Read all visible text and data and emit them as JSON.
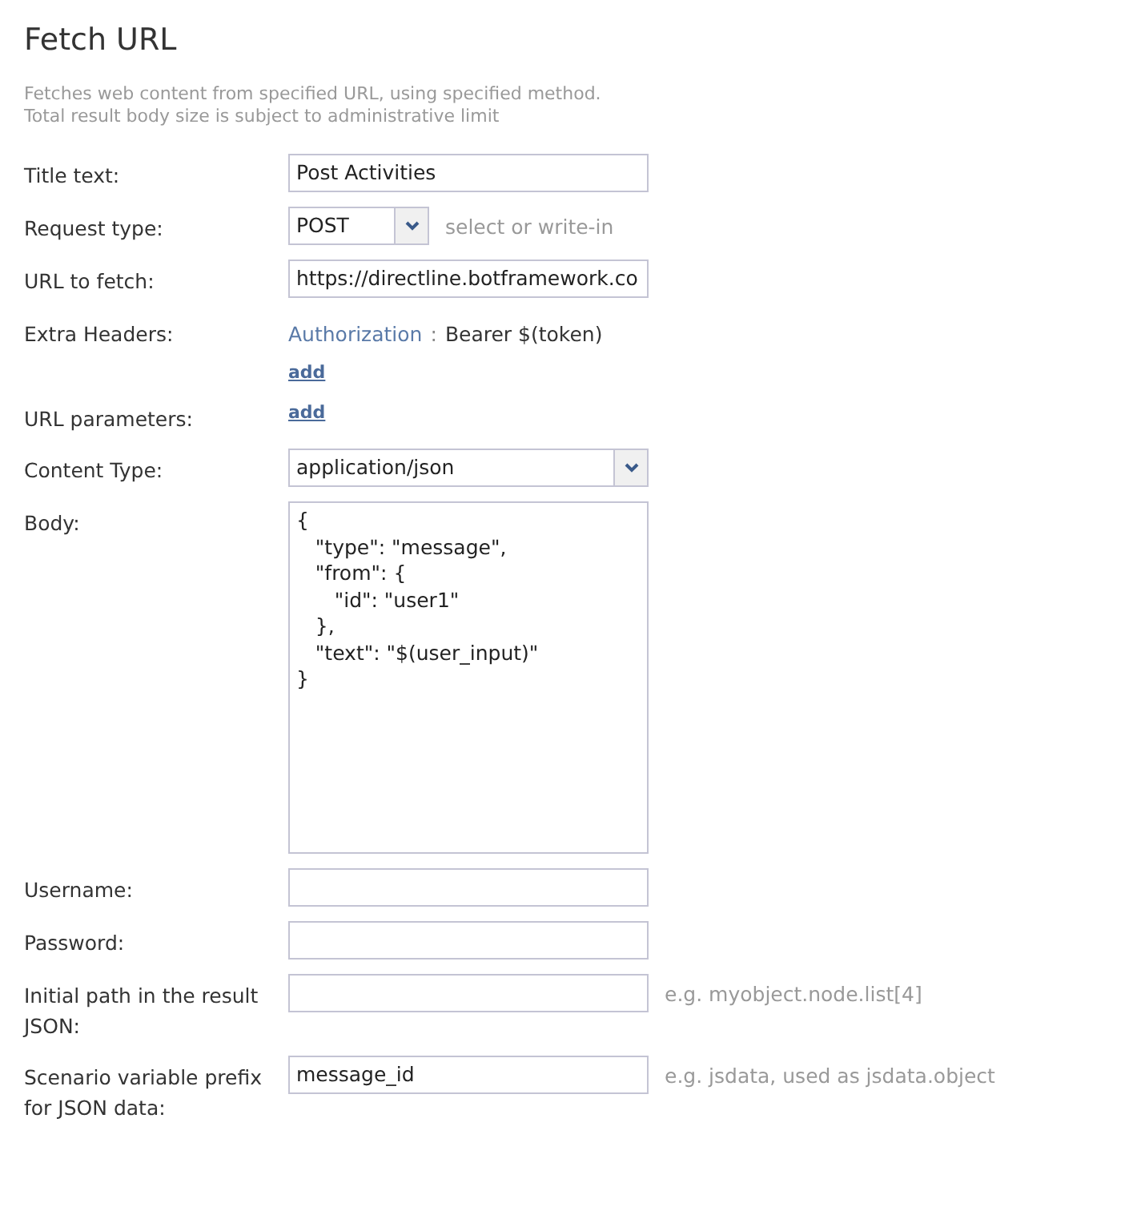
{
  "title": "Fetch URL",
  "description": [
    "Fetches web content from specified URL, using specified method.",
    "Total result body size is subject to administrative limit"
  ],
  "rows": [
    {
      "kind": "text",
      "label": "Title text:",
      "value": "Post Activities"
    },
    {
      "kind": "combo",
      "label": "Request type:",
      "value": "POST",
      "hint": "select or write-in"
    },
    {
      "kind": "text",
      "label": "URL to fetch:",
      "value": "https://directline.botframework.co"
    },
    {
      "kind": "headers",
      "label": "Extra Headers:",
      "headers": [
        {
          "name": "Authorization",
          "separator": ":",
          "value": "Bearer $(token)"
        }
      ],
      "link": "add"
    },
    {
      "kind": "link",
      "label": "URL parameters:",
      "link": "add"
    },
    {
      "kind": "select",
      "label": "Content Type:",
      "value": "application/json"
    },
    {
      "kind": "area",
      "label": "Body:",
      "value": "{\n   \"type\": \"message\",\n   \"from\": {\n      \"id\": \"user1\"\n   },\n   \"text\": \"$(user_input)\"\n}"
    },
    {
      "kind": "text",
      "label": "Username:",
      "value": ""
    },
    {
      "kind": "text",
      "label": "Password:",
      "value": ""
    },
    {
      "kind": "text",
      "label": "Initial path in the result JSON:",
      "value": "",
      "hint": "e.g. myobject.node.list[4]"
    },
    {
      "kind": "text",
      "label": "Scenario variable prefix for JSON data:",
      "value": "message_id",
      "hint": "e.g. jsdata, used as jsdata.object"
    }
  ]
}
